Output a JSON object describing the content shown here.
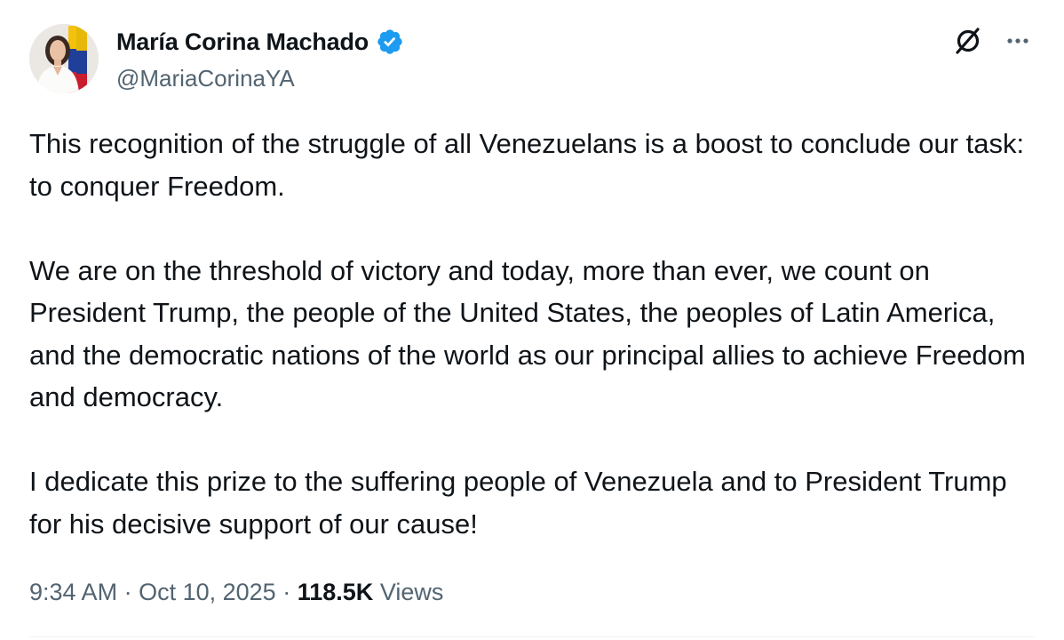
{
  "author": {
    "display_name": "María Corina Machado",
    "handle": "@MariaCorinaYA",
    "verified_icon": "verified-badge-icon",
    "verified_color": "#1d9bf0",
    "avatar": "profile-photo"
  },
  "actions": {
    "grok_icon": "grok-icon",
    "more_icon": "more-options-icon"
  },
  "tweet": {
    "paragraphs": [
      "This recognition of the struggle of all Venezuelans is a boost to conclude our task: to conquer Freedom.",
      "We are on the threshold of victory and today, more than ever, we count on President Trump, the people of the United States, the peoples of Latin America, and the democratic nations of the world as our principal allies to achieve Freedom and democracy.",
      "I dedicate this prize to the suffering people of Venezuela and to President Trump for his decisive support of our cause!"
    ]
  },
  "meta": {
    "time": "9:34 AM",
    "separator": "·",
    "date": "Oct 10, 2025",
    "views_count": "118.5K",
    "views_label": "Views"
  }
}
